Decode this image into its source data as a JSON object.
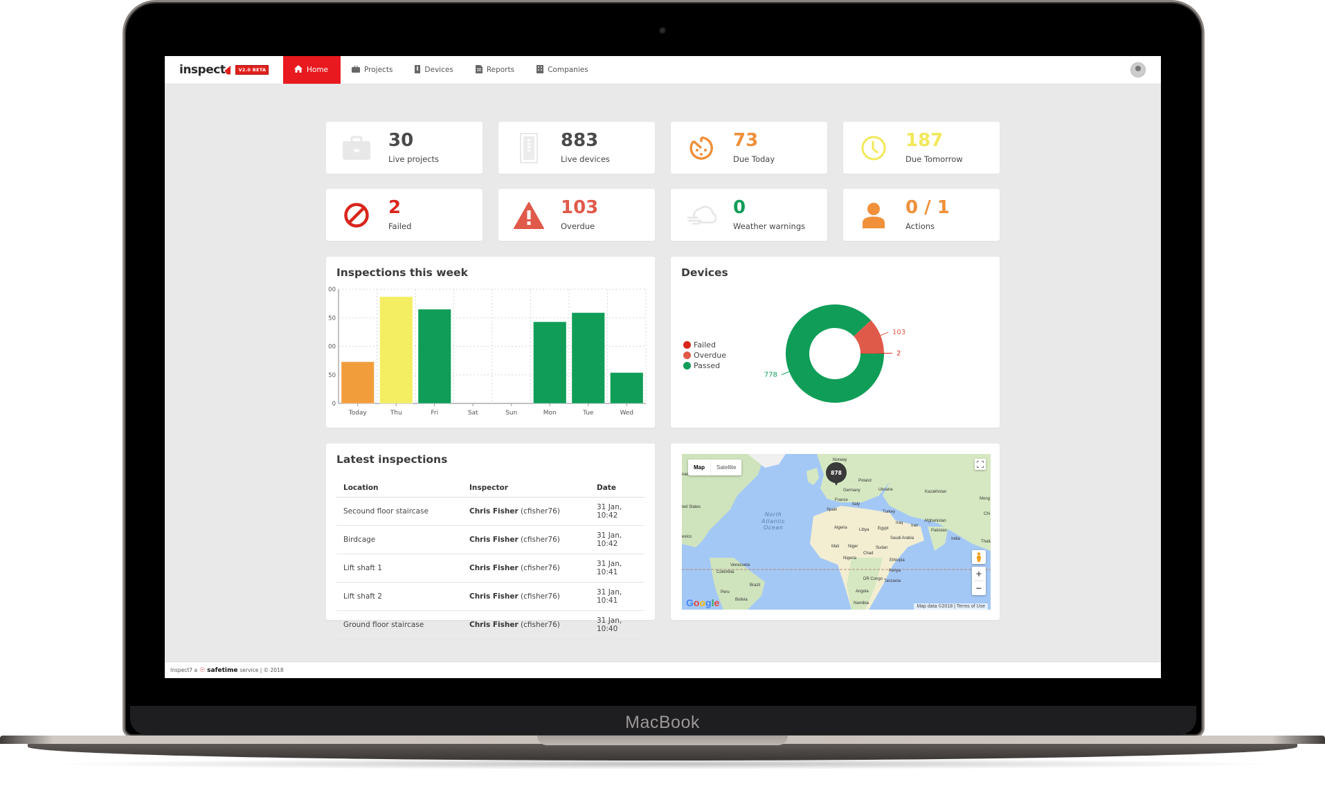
{
  "device": {
    "brand": "MacBook"
  },
  "app": {
    "logo": "inspect",
    "version_badge": "V2.0 BETA",
    "user_avatar": "user-avatar"
  },
  "nav": {
    "items": [
      {
        "label": "Home",
        "icon": "home-icon",
        "active": true
      },
      {
        "label": "Projects",
        "icon": "briefcase-icon",
        "active": false
      },
      {
        "label": "Devices",
        "icon": "device-icon",
        "active": false
      },
      {
        "label": "Reports",
        "icon": "report-icon",
        "active": false
      },
      {
        "label": "Companies",
        "icon": "building-icon",
        "active": false
      }
    ]
  },
  "stats": [
    {
      "value": "30",
      "label": "Live projects",
      "icon": "briefcase-icon",
      "color": "#4a4a4a",
      "icon_color": "#e6e6e6"
    },
    {
      "value": "883",
      "label": "Live devices",
      "icon": "device-panel-icon",
      "color": "#4a4a4a",
      "icon_color": "#e6e6e6"
    },
    {
      "value": "73",
      "label": "Due Today",
      "icon": "timer-icon",
      "color": "#f0903a",
      "icon_color": "#f0903a"
    },
    {
      "value": "187",
      "label": "Due Tomorrow",
      "icon": "clock-icon",
      "color": "#f2e85a",
      "icon_color": "#f2e85a"
    },
    {
      "value": "2",
      "label": "Failed",
      "icon": "ban-icon",
      "color": "#d9261c",
      "icon_color": "#d9261c"
    },
    {
      "value": "103",
      "label": "Overdue",
      "icon": "warning-icon",
      "color": "#e05a4a",
      "icon_color": "#e05a4a"
    },
    {
      "value": "0",
      "label": "Weather warnings",
      "icon": "cloud-wind-icon",
      "color": "#0f9d58",
      "icon_color": "#e6e6e6"
    },
    {
      "value": "0 / 1",
      "label": "Actions",
      "icon": "user-icon",
      "color": "#f0903a",
      "icon_color": "#f0903a"
    }
  ],
  "inspections_panel": {
    "title": "Inspections this week"
  },
  "devices_panel": {
    "title": "Devices"
  },
  "latest": {
    "title": "Latest inspections",
    "columns": [
      "Location",
      "Inspector",
      "Date"
    ],
    "rows": [
      {
        "location": "Secound floor staircase",
        "inspector_name": "Chris Fisher",
        "inspector_user": "(cfisher76)",
        "date": "31 Jan, 10:42"
      },
      {
        "location": "Birdcage",
        "inspector_name": "Chris Fisher",
        "inspector_user": "(cfisher76)",
        "date": "31 Jan, 10:42"
      },
      {
        "location": "Lift shaft 1",
        "inspector_name": "Chris Fisher",
        "inspector_user": "(cfisher76)",
        "date": "31 Jan, 10:41"
      },
      {
        "location": "Lift shaft 2",
        "inspector_name": "Chris Fisher",
        "inspector_user": "(cfisher76)",
        "date": "31 Jan, 10:41"
      },
      {
        "location": "Ground floor staircase",
        "inspector_name": "Chris Fisher",
        "inspector_user": "(cfisher76)",
        "date": "31 Jan, 10:40"
      }
    ]
  },
  "map": {
    "type_buttons": [
      "Map",
      "Satellite"
    ],
    "cluster_count": "878",
    "ocean_label": [
      "North",
      "Atlantic",
      "Ocean"
    ],
    "labels": [
      "Norway",
      "Poland",
      "Germany",
      "Ukraine",
      "Kazakhstan",
      "France",
      "Italy",
      "Spain",
      "Turkey",
      "Iraq",
      "Iran",
      "Afghanistan",
      "Pakistan",
      "Algeria",
      "Libya",
      "Egypt",
      "Saudi Arabia",
      "India",
      "Mali",
      "Niger",
      "Chad",
      "Sudan",
      "Nigeria",
      "Ethiopia",
      "Kenya",
      "DR Congo",
      "Tanzania",
      "Angola",
      "Namibia",
      "Venezuela",
      "Colombia",
      "Brazil",
      "Peru",
      "Bolivia",
      "ted States",
      "exico",
      "nada",
      "Mong",
      "Chi",
      "Thailan"
    ],
    "zoom_in": "+",
    "zoom_out": "−",
    "attribution": "Map data ©2018  |  Terms of Use",
    "google_logo": "Google"
  },
  "footer": {
    "prefix": "Inspect7 a",
    "brand": "safetime",
    "suffix": "service | © 2018"
  },
  "chart_data": [
    {
      "type": "bar",
      "title": "Inspections this week",
      "categories": [
        "Today",
        "Thu",
        "Fri",
        "Sat",
        "Sun",
        "Mon",
        "Tue",
        "Wed"
      ],
      "values": [
        73,
        187,
        165,
        0,
        0,
        143,
        159,
        54
      ],
      "colors": [
        "#f29d3c",
        "#f3ee62",
        "#0f9d58",
        "#0f9d58",
        "#0f9d58",
        "#0f9d58",
        "#0f9d58",
        "#0f9d58"
      ],
      "ylim": [
        0,
        200
      ],
      "yticks": [
        0,
        50,
        100,
        150,
        200
      ],
      "ytick_labels_visible": [
        "0",
        "50",
        "00",
        "50",
        "00"
      ],
      "grid": true,
      "xlabel": "",
      "ylabel": ""
    },
    {
      "type": "pie",
      "variant": "donut",
      "title": "Devices",
      "labels": [
        "Failed",
        "Overdue",
        "Passed"
      ],
      "values": [
        2,
        103,
        778
      ],
      "colors": [
        "#d9261c",
        "#e05a4a",
        "#0f9d58"
      ],
      "legend": "left"
    }
  ]
}
